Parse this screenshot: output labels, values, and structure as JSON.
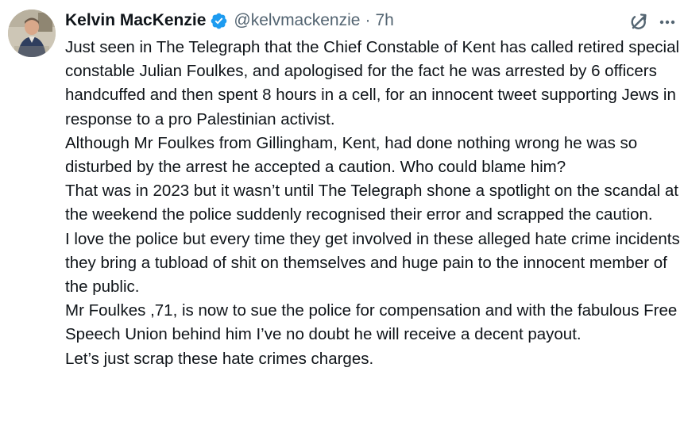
{
  "author": {
    "display_name": "Kelvin MacKenzie",
    "handle": "@kelvmackenzie",
    "separator": "·",
    "timestamp": "7h",
    "verified": true,
    "verified_color": "#1d9bf0"
  },
  "icons": {
    "grok": "grok-icon",
    "more": "more-options-icon",
    "verified": "verified-badge-icon"
  },
  "tweet": {
    "paragraphs": [
      "Just seen in The Telegraph that the Chief Constable of Kent has called retired special constable Julian Foulkes, and apologised for the fact he was arrested by 6  officers  handcuffed and then spent 8 hours in a cell, for an innocent tweet supporting Jews in response to a pro Palestinian activist.",
      "Although Mr Foulkes from Gillingham, Kent, had done nothing wrong he was so disturbed by the arrest he accepted a caution. Who could blame him?",
      "That was in 2023 but it wasn’t until The Telegraph shone a spotlight on the scandal at the weekend the police suddenly recognised their error and scrapped the caution.",
      "I love the police but every time they get involved in these alleged hate crime incidents they bring a tubload of shit on themselves and huge pain to the innocent member of the public.",
      "Mr Foulkes ,71, is now to sue the police for compensation and with the fabulous Free Speech Union behind him I’ve no doubt he will receive a decent payout.",
      "Let’s just scrap these hate crimes charges."
    ]
  },
  "colors": {
    "text": "#0f1419",
    "secondary": "#536471",
    "background": "#ffffff"
  }
}
